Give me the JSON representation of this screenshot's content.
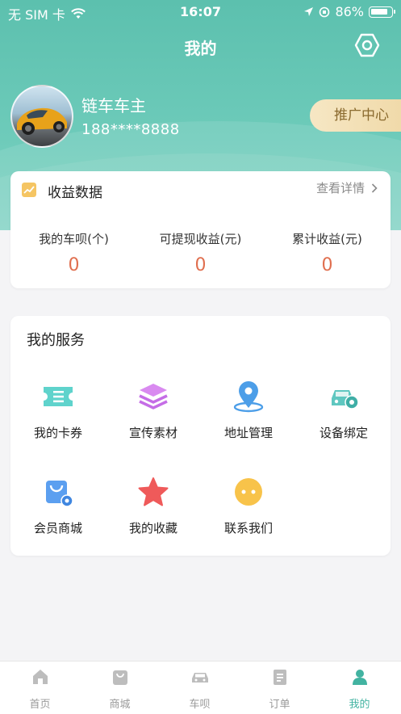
{
  "status_bar": {
    "carrier": "无 SIM 卡",
    "time": "16:07",
    "battery": "86%"
  },
  "header": {
    "title": "我的"
  },
  "profile": {
    "name": "链车车主",
    "phone": "188****8888",
    "promo_label": "推广中心"
  },
  "earnings": {
    "title": "收益数据",
    "detail_link": "查看详情",
    "stats": [
      {
        "label": "我的车呗(个)",
        "value": "0"
      },
      {
        "label": "可提现收益(元)",
        "value": "0"
      },
      {
        "label": "累计收益(元)",
        "value": "0"
      }
    ],
    "value_color": "#e06f4f"
  },
  "services": {
    "title": "我的服务",
    "items": [
      {
        "label": "我的卡券",
        "icon": "ticket-icon"
      },
      {
        "label": "宣传素材",
        "icon": "layers-icon"
      },
      {
        "label": "地址管理",
        "icon": "location-pin-icon"
      },
      {
        "label": "设备绑定",
        "icon": "car-device-icon"
      },
      {
        "label": "会员商城",
        "icon": "shopping-bag-icon"
      },
      {
        "label": "我的收藏",
        "icon": "star-icon"
      },
      {
        "label": "联系我们",
        "icon": "chat-bubble-icon"
      }
    ]
  },
  "tabbar": {
    "items": [
      {
        "label": "首页",
        "icon": "home-icon"
      },
      {
        "label": "商城",
        "icon": "shop-icon"
      },
      {
        "label": "车呗",
        "icon": "car-icon"
      },
      {
        "label": "订单",
        "icon": "order-icon"
      },
      {
        "label": "我的",
        "icon": "user-icon"
      }
    ],
    "active_index": 4,
    "active_color": "#42b3a1"
  },
  "theme": {
    "header_color": "#5cc0ae"
  }
}
